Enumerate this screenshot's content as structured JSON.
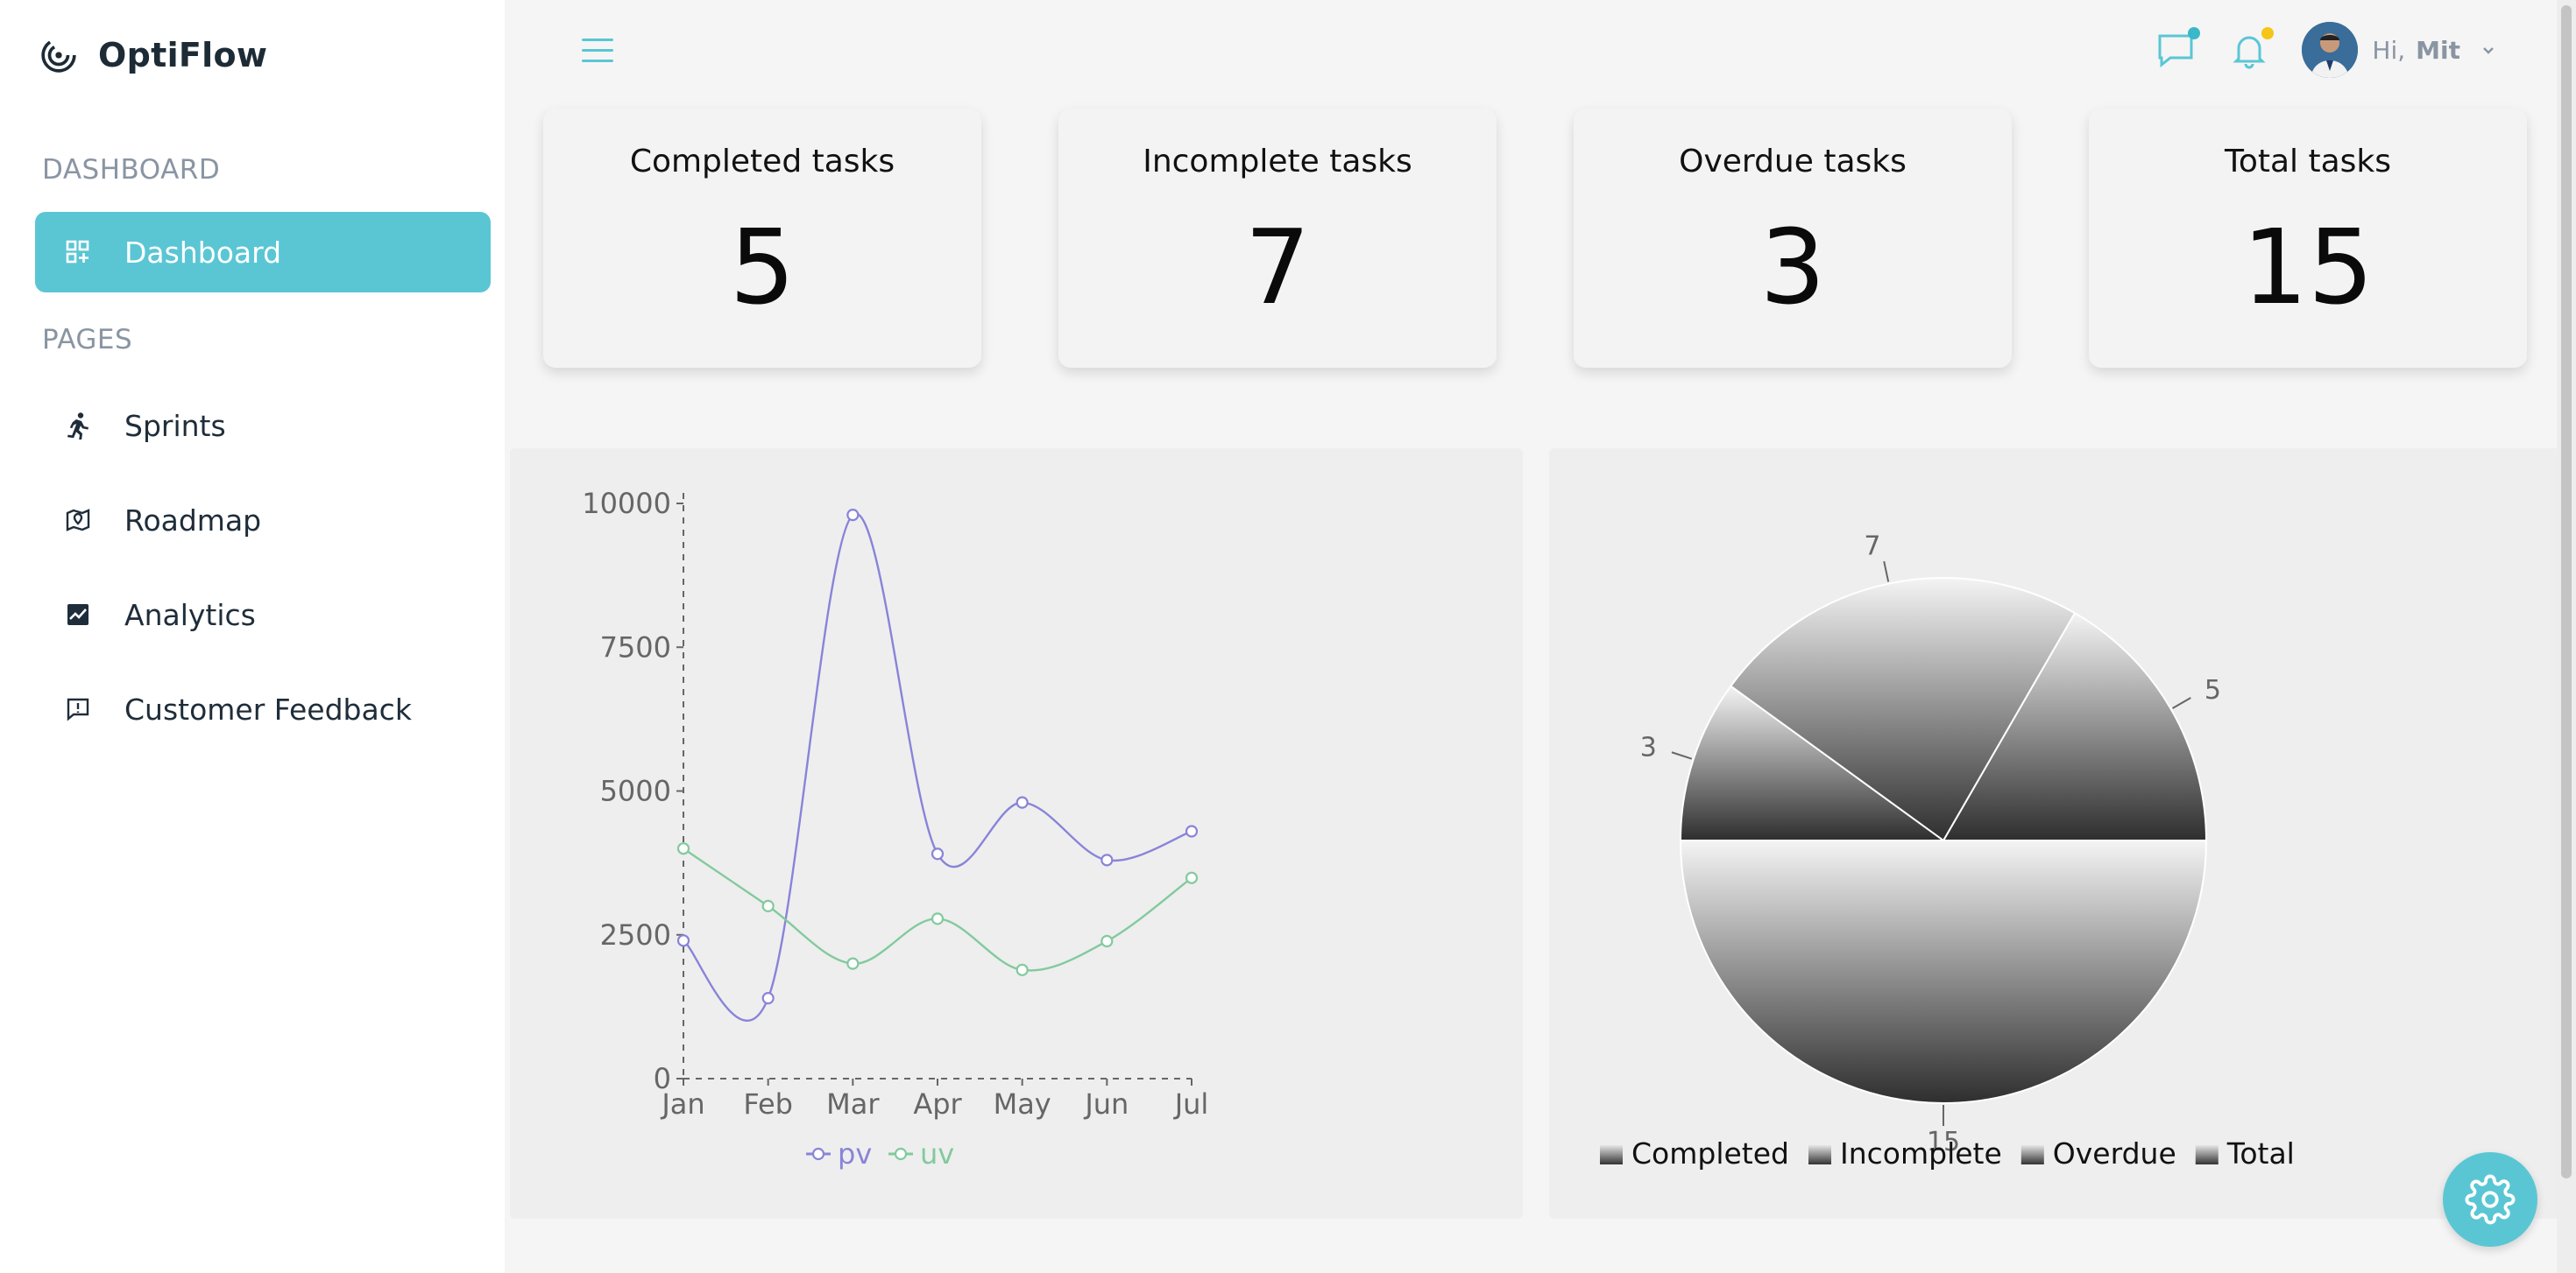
{
  "app": {
    "name": "OptiFlow"
  },
  "sidebar": {
    "section_dashboard": "DASHBOARD",
    "section_pages": "PAGES",
    "items": [
      {
        "label": "Dashboard",
        "icon": "dashboard-grid-icon",
        "active": true
      },
      {
        "label": "Sprints",
        "icon": "running-person-icon"
      },
      {
        "label": "Roadmap",
        "icon": "map-pin-icon"
      },
      {
        "label": "Analytics",
        "icon": "chart-icon"
      },
      {
        "label": "Customer Feedback",
        "icon": "feedback-icon"
      }
    ]
  },
  "topbar": {
    "greeting": "Hi,",
    "username": "Mit",
    "message_dot_color": "#3ab7c8",
    "notification_dot_color": "#f5c518"
  },
  "stats": [
    {
      "title": "Completed tasks",
      "value": "5"
    },
    {
      "title": "Incomplete tasks",
      "value": "7"
    },
    {
      "title": "Overdue tasks",
      "value": "3"
    },
    {
      "title": "Total tasks",
      "value": "15"
    }
  ],
  "colors": {
    "accent": "#5ac6d4",
    "pv": "#8884d8",
    "uv": "#82ca9d"
  },
  "chart_data": [
    {
      "type": "line",
      "categories": [
        "Jan",
        "Feb",
        "Mar",
        "Apr",
        "May",
        "Jun",
        "Jul"
      ],
      "yticks": [
        0,
        2500,
        5000,
        7500,
        10000
      ],
      "ylim": [
        0,
        10000
      ],
      "series": [
        {
          "name": "pv",
          "values": [
            2400,
            1398,
            9800,
            3908,
            4800,
            3800,
            4300
          ]
        },
        {
          "name": "uv",
          "values": [
            4000,
            3000,
            2000,
            2780,
            1890,
            2390,
            3490
          ]
        }
      ],
      "legend": "bottom-center",
      "grid": false
    },
    {
      "type": "pie",
      "slices": [
        {
          "name": "Completed",
          "value": 5
        },
        {
          "name": "Incomplete",
          "value": 7
        },
        {
          "name": "Overdue",
          "value": 3
        },
        {
          "name": "Total",
          "value": 15
        }
      ],
      "legend": "bottom-center"
    }
  ]
}
